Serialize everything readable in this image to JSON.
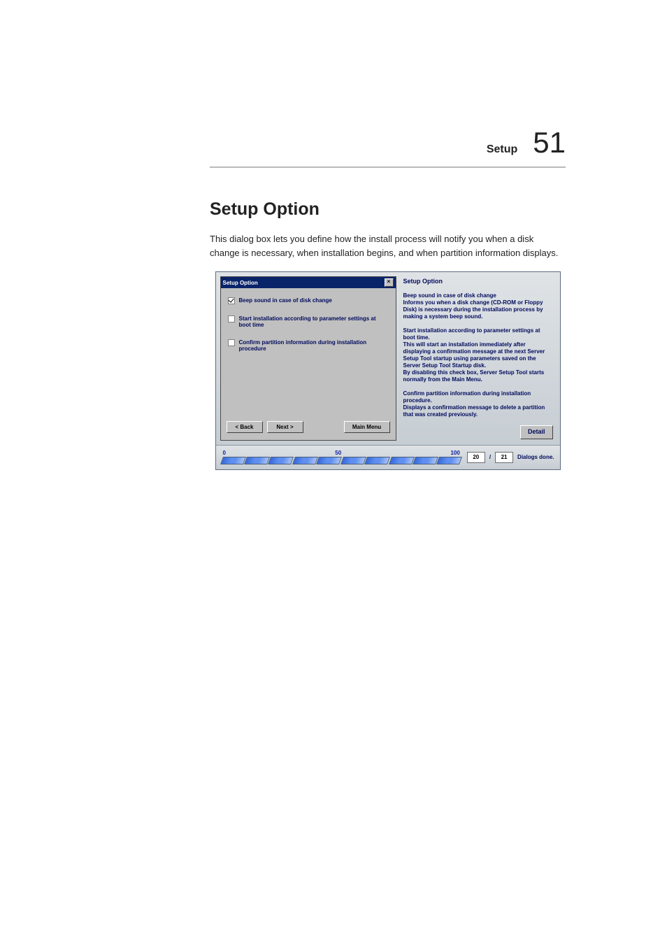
{
  "header": {
    "label": "Setup",
    "page_number": "51"
  },
  "section": {
    "title": "Setup Option",
    "paragraph": "This dialog box lets you define how the install process will notify you when a disk change is necessary, when installation begins, and when partition information displays."
  },
  "dialog": {
    "title": "Setup Option",
    "checks": [
      {
        "label": "Beep sound in case of disk change",
        "checked": true
      },
      {
        "label": "Start installation according to parameter settings at boot time",
        "checked": false
      },
      {
        "label": "Confirm partition information during installation procedure",
        "checked": false
      }
    ],
    "buttons": {
      "back": "< Back",
      "next": "Next >",
      "main": "Main Menu"
    }
  },
  "help": {
    "title": "Setup Option",
    "blocks": [
      "Beep sound in case of disk change\n  Informs you when a disk change (CD-ROM or Floppy Disk) is necessary during the installation process by making a system beep sound.",
      "Start installation according to parameter settings at boot time.\n  This will start an installation immediately after displaying a confirmation message at the next Server Setup Tool startup using parameters saved on the Server Setup Tool Startup disk.\n  By disabling this check box, Server Setup Tool starts normally from the Main Menu.",
      "Confirm partition information during installation procedure.\n  Displays a confirmation message to delete a partition that was created previously."
    ],
    "detail_button": "Detail"
  },
  "progress": {
    "min": "0",
    "mid": "50",
    "max": "100",
    "current": "20",
    "total": "21",
    "status_text": "Dialogs done."
  }
}
